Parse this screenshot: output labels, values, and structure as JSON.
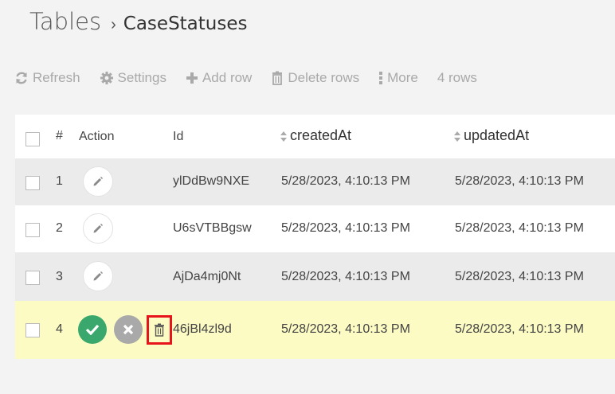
{
  "breadcrumb": {
    "root": "Tables",
    "separator": "›",
    "page": "CaseStatuses"
  },
  "toolbar": {
    "refresh": "Refresh",
    "settings": "Settings",
    "add_row": "Add row",
    "delete_rows": "Delete rows",
    "more": "More",
    "row_count": "4 rows"
  },
  "table": {
    "columns": {
      "index": "#",
      "action": "Action",
      "id": "Id",
      "created_at": "createdAt",
      "updated_at": "updatedAt"
    },
    "rows": [
      {
        "num": "1",
        "id": "ylDdBw9NXE",
        "created_at": "5/28/2023, 4:10:13 PM",
        "updated_at": "5/28/2023, 4:10:13 PM"
      },
      {
        "num": "2",
        "id": "U6sVTBBgsw",
        "created_at": "5/28/2023, 4:10:13 PM",
        "updated_at": "5/28/2023, 4:10:13 PM"
      },
      {
        "num": "3",
        "id": "AjDa4mj0Nt",
        "created_at": "5/28/2023, 4:10:13 PM",
        "updated_at": "5/28/2023, 4:10:13 PM"
      },
      {
        "num": "4",
        "id": "46jBl4zl9d",
        "created_at": "5/28/2023, 4:10:13 PM",
        "updated_at": "5/28/2023, 4:10:13 PM"
      }
    ]
  },
  "icons": {
    "refresh": "refresh-icon",
    "settings": "gear-icon",
    "add": "plus-icon",
    "delete": "trash-icon",
    "more": "vertical-dots-icon",
    "edit": "pencil-icon",
    "confirm": "check-icon",
    "cancel": "close-icon",
    "sort": "sort-icon"
  },
  "colors": {
    "confirm": "#3aa86c",
    "cancel": "#a9a9a9",
    "highlight_box": "#e8141b",
    "editing_row": "#fcfbc4",
    "striped_row": "#ebebeb"
  }
}
